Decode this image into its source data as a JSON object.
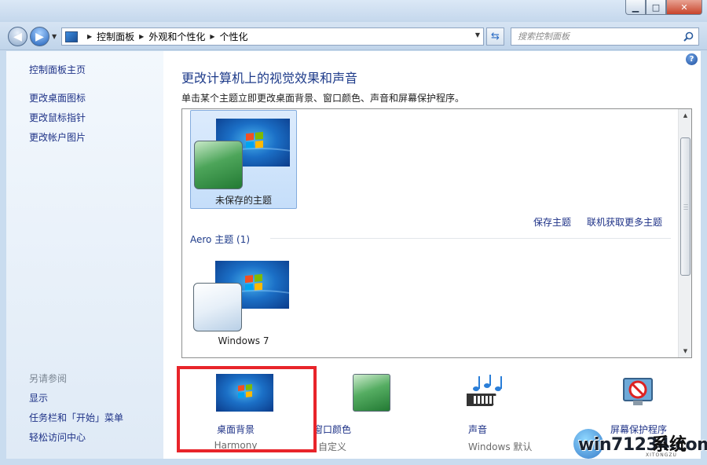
{
  "window": {
    "min_label": "▁",
    "max_label": "□",
    "close_label": "✕"
  },
  "nav": {
    "breadcrumbs": [
      "控制面板",
      "外观和个性化",
      "个性化"
    ],
    "search_placeholder": "搜索控制面板"
  },
  "sidebar": {
    "top_links": [
      "控制面板主页",
      "更改桌面图标",
      "更改鼠标指针",
      "更改帐户图片"
    ],
    "see_also_heading": "另请参阅",
    "see_also_links": [
      "显示",
      "任务栏和「开始」菜单",
      "轻松访问中心"
    ]
  },
  "main": {
    "title": "更改计算机上的视觉效果和声音",
    "subtitle": "单击某个主题立即更改桌面背景、窗口颜色、声音和屏幕保护程序。",
    "unsaved_theme_label": "未保存的主题",
    "save_theme_link": "保存主题",
    "get_more_link": "联机获取更多主题",
    "aero_group_heading": "Aero 主题 (1)",
    "aero_theme_label": "Windows 7"
  },
  "bottom": {
    "desktop_background": {
      "title": "桌面背景",
      "value": "Harmony"
    },
    "window_color": {
      "title": "窗口颜色",
      "value": "自定义"
    },
    "sounds": {
      "title": "声音",
      "value": "Windows 默认"
    },
    "screensaver": {
      "title": "屏幕保护程序"
    }
  },
  "watermark": {
    "text": "win71234.com",
    "brand": "系统",
    "small": "XITONGZU"
  },
  "colors": {
    "link": "#1e3287",
    "title": "#1e3b8a",
    "highlight": "#e8242a"
  }
}
